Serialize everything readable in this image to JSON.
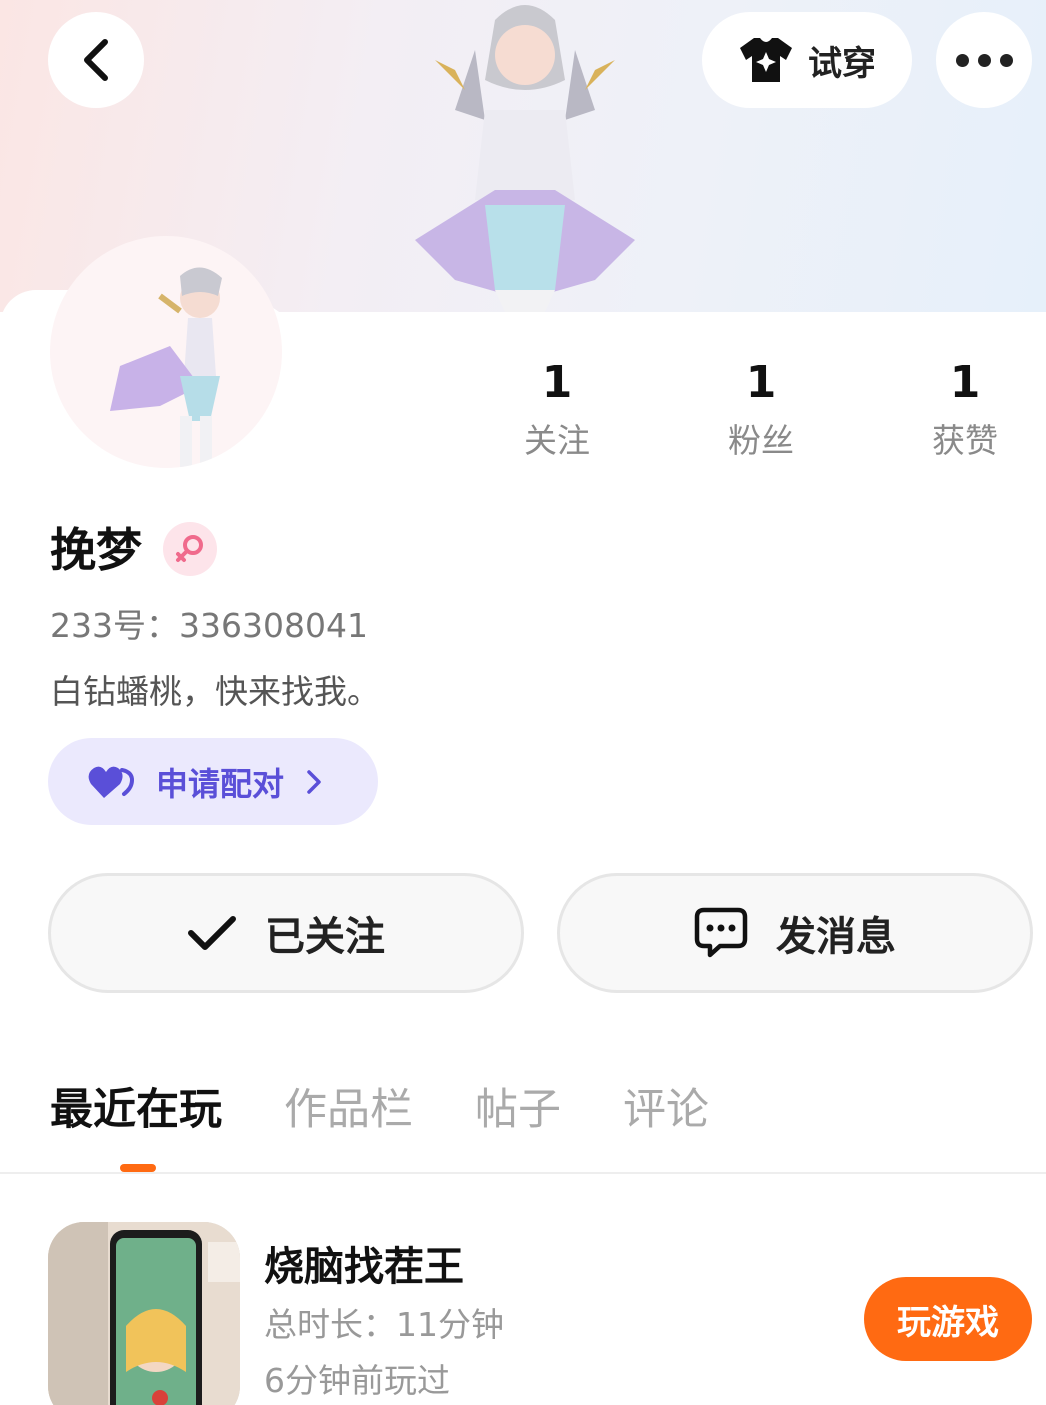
{
  "header": {
    "tryon_label": "试穿",
    "icons": {
      "back": "chevron-left-icon",
      "tryon": "tshirt-icon",
      "more": "more-dots-icon"
    }
  },
  "profile": {
    "stats": [
      {
        "value": "1",
        "label": "关注"
      },
      {
        "value": "1",
        "label": "粉丝"
      },
      {
        "value": "1",
        "label": "获赞"
      }
    ],
    "name": "挽梦",
    "gender": "female",
    "id_line": "233号：336308041",
    "bio": "白钻蟠桃，快来找我。",
    "pair_button": "申请配对",
    "follow_button": "已关注",
    "message_button": "发消息"
  },
  "tabs": [
    {
      "label": "最近在玩",
      "active": true
    },
    {
      "label": "作品栏",
      "active": false
    },
    {
      "label": "帖子",
      "active": false
    },
    {
      "label": "评论",
      "active": false
    }
  ],
  "recent_game": {
    "title": "烧脑找茬王",
    "duration": "总时长：11分钟",
    "last_played": "6分钟前玩过",
    "play_button": "玩游戏"
  },
  "colors": {
    "accent": "#ff6a12",
    "pair_bg": "#ebe9fd",
    "pair_text": "#5a4fd8",
    "gender_badge_bg": "#fde4ea",
    "gender_icon": "#f06a8c"
  }
}
